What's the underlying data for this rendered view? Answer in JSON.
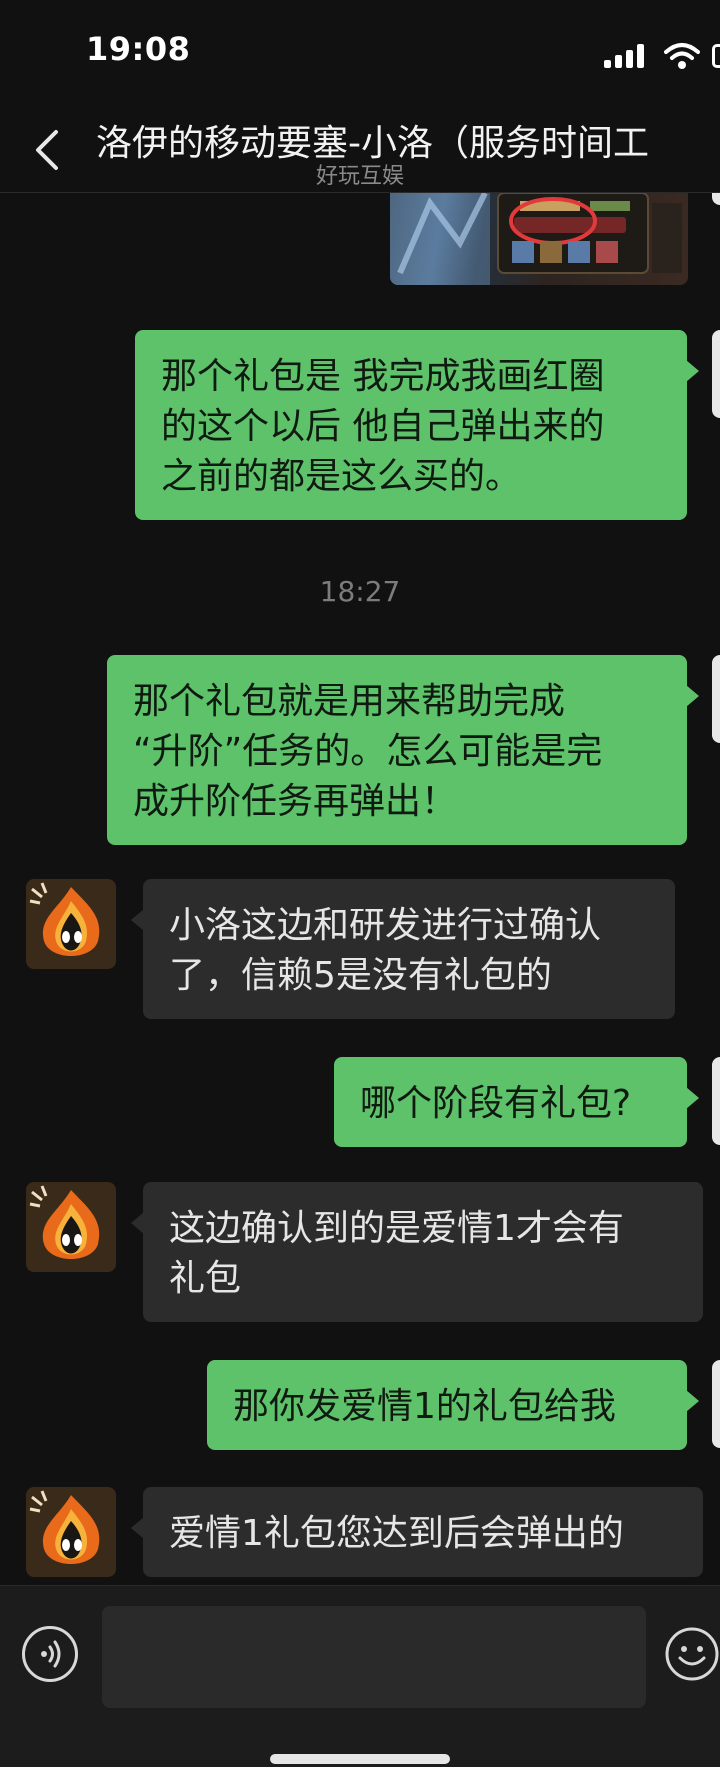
{
  "status": {
    "time": "19:08"
  },
  "header": {
    "title": "洛伊的移动要塞-小洛（服务时间工",
    "subtitle": "好玩互娱"
  },
  "messages": [
    {
      "id": "m1",
      "side": "me",
      "type": "image"
    },
    {
      "id": "m2",
      "side": "me",
      "lines": [
        "那个礼包是 我完成我画红圈",
        "的这个以后 他自己弹出来的",
        "之前的都是这么买的。"
      ]
    },
    {
      "id": "ts1",
      "type": "timestamp",
      "text": "18:27"
    },
    {
      "id": "m3",
      "side": "me",
      "lines": [
        "那个礼包就是用来帮助完成",
        "“升阶”任务的。怎么可能是完",
        "成升阶任务再弹出！"
      ]
    },
    {
      "id": "m4",
      "side": "them",
      "lines": [
        "小洛这边和研发进行过确认",
        "了，信赖5是没有礼包的"
      ]
    },
    {
      "id": "m5",
      "side": "me",
      "lines": [
        "哪个阶段有礼包?"
      ]
    },
    {
      "id": "m6",
      "side": "them",
      "lines": [
        "这边确认到的是爱情1才会有",
        "礼包"
      ]
    },
    {
      "id": "m7",
      "side": "me",
      "lines": [
        "那你发爱情1的礼包给我"
      ]
    },
    {
      "id": "m8",
      "side": "them",
      "lines": [
        "爱情1礼包您达到后会弹出的"
      ]
    }
  ],
  "input": {
    "value": "",
    "placeholder": ""
  },
  "icons": {
    "back": "chevron-left-icon",
    "voice": "voice-icon",
    "emoji": "emoji-icon"
  },
  "colors": {
    "background": "#111111",
    "my_bubble": "#5ec26b",
    "their_bubble": "#2c2c2c",
    "timestamp": "#7c7c7c"
  }
}
